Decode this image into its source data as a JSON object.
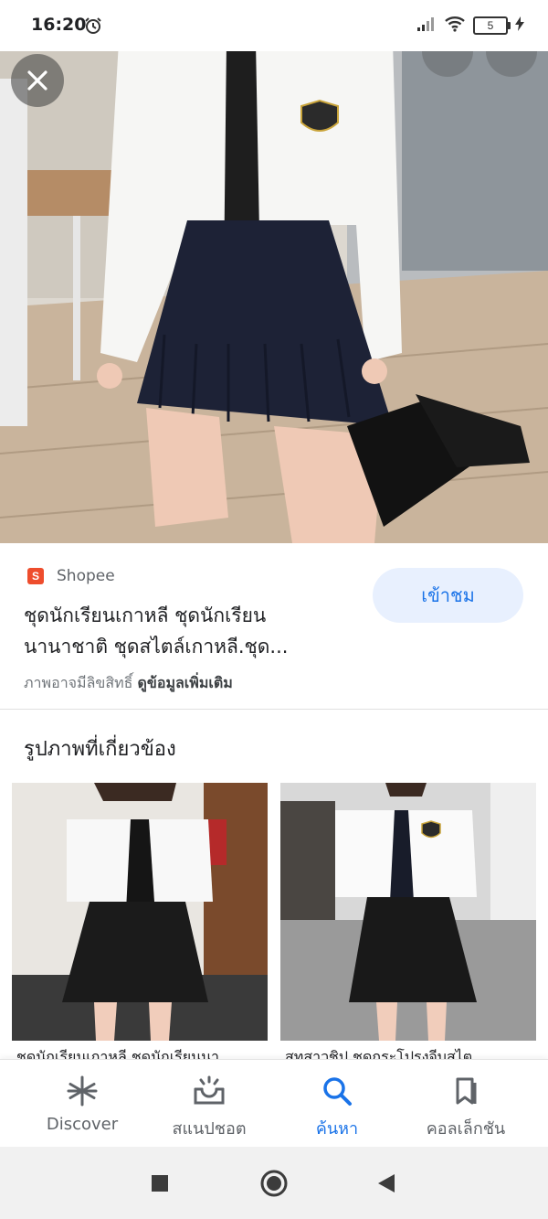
{
  "status_bar": {
    "time": "16:20",
    "battery_level": "5"
  },
  "colors": {
    "accent": "#1a73e8",
    "shopee": "#ee4d2d",
    "visit_bg": "#e8f0fe"
  },
  "result": {
    "source": "Shopee",
    "source_icon_glyph": "S",
    "title_line1": "ชุดนักเรียนเกาหลี ชุดนักเรียน",
    "title_line2": "นานาชาติ ชุดสไตล์เกาหลี.ชุด...",
    "visit_button": "เข้าชม",
    "copyright_prefix": "ภาพอาจมีลิขสิทธิ์",
    "more_info_link": "ดูข้อมูลเพิ่มเติม"
  },
  "related": {
    "heading": "รูปภาพที่เกี่ยวข้อง",
    "items": [
      {
        "caption": "ชุดนักเรียนเกาหลี ชุดนักเรียนนา"
      },
      {
        "caption": "สูทสาวชิป ชุดกระโปรงจีบสไต"
      }
    ]
  },
  "bottom_nav": {
    "items": [
      {
        "label": "Discover",
        "icon": "asterisk-icon",
        "active": false
      },
      {
        "label": "สแนปชอต",
        "icon": "snapshot-icon",
        "active": false
      },
      {
        "label": "ค้นหา",
        "icon": "search-icon",
        "active": true
      },
      {
        "label": "คอลเล็กชัน",
        "icon": "collections-icon",
        "active": false
      }
    ]
  },
  "system_nav": [
    "recents-icon",
    "home-icon",
    "back-icon"
  ]
}
